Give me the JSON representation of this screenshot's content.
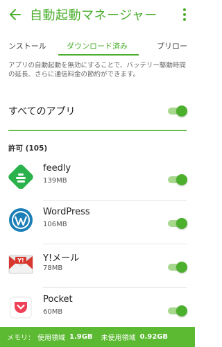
{
  "header": {
    "title": "自動起動マネージャー",
    "back_icon": "back-arrow-icon",
    "menu_icon": "overflow-menu-icon"
  },
  "tabs": [
    {
      "label": "ンストール"
    },
    {
      "label": "ダウンロード済み",
      "active": true
    },
    {
      "label": "プリロー"
    }
  ],
  "description": "アプリの自動起動を無効にすることで、バッテリー駆動時間の延長、さらに通信料金の節約ができます。",
  "all_apps": {
    "label": "すべてのアプリ",
    "enabled": true
  },
  "section": {
    "label": "許可 (105)"
  },
  "apps": [
    {
      "name": "feedly",
      "size": "139MB",
      "icon": "feedly-icon",
      "enabled": true
    },
    {
      "name": "WordPress",
      "size": "106MB",
      "icon": "wordpress-icon",
      "enabled": true
    },
    {
      "name": "Y!メール",
      "size": "78MB",
      "icon": "yahoo-mail-icon",
      "enabled": true
    },
    {
      "name": "Pocket",
      "size": "60MB",
      "icon": "pocket-icon",
      "enabled": true
    }
  ],
  "footer": {
    "memory_label": "メモリ：",
    "used_label": "使用領域",
    "used_value": "1.9GB",
    "free_label": "未使用領域",
    "free_value": "0.92GB"
  },
  "colors": {
    "accent": "#4caf2e",
    "track": "#a8d88e",
    "footer": "#5cb932"
  }
}
